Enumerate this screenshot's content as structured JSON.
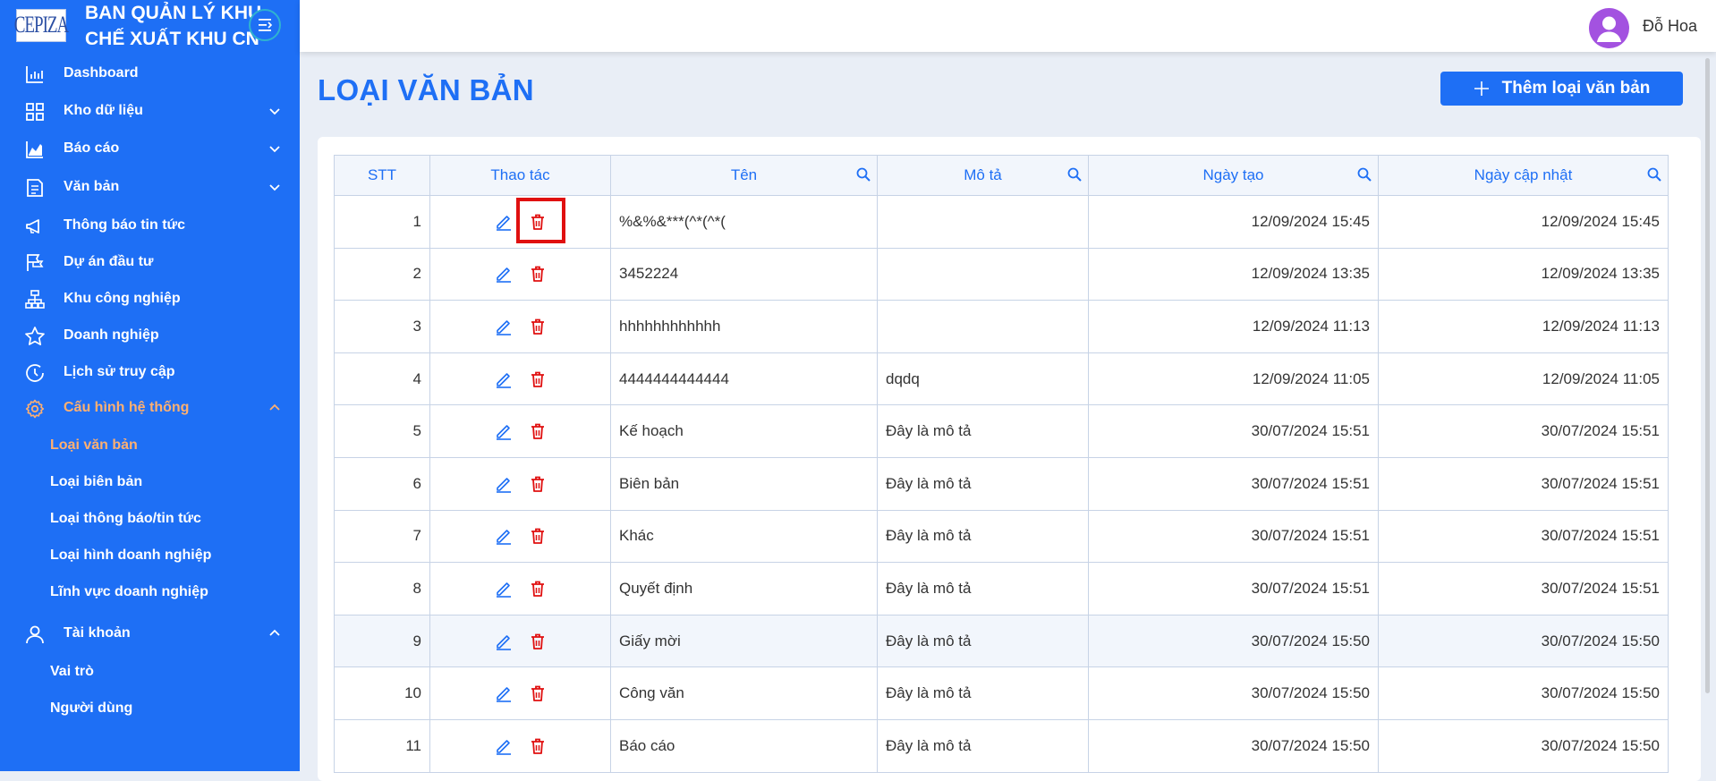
{
  "brand": {
    "logo_text": "CEPIZA",
    "title_line1": "BAN QUẢN LÝ KHU",
    "title_line2": "CHẾ XUẤT KHU CN"
  },
  "sidebar": {
    "items": [
      {
        "label": "Dashboard",
        "icon": "bar-chart-icon"
      },
      {
        "label": "Kho dữ liệu",
        "icon": "grid-icon",
        "chevron": "down"
      },
      {
        "label": "Báo cáo",
        "icon": "area-chart-icon",
        "chevron": "down"
      },
      {
        "label": "Văn bản",
        "icon": "document-icon",
        "chevron": "down"
      },
      {
        "label": "Thông báo tin tức",
        "icon": "megaphone-icon"
      },
      {
        "label": "Dự án đầu tư",
        "icon": "flag-icon"
      },
      {
        "label": "Khu công nghiệp",
        "icon": "sitemap-icon"
      },
      {
        "label": "Doanh nghiệp",
        "icon": "star-icon"
      },
      {
        "label": "Lịch sử truy cập",
        "icon": "clock-icon"
      },
      {
        "label": "Cấu hình hệ thống",
        "icon": "gear-icon",
        "chevron": "up",
        "open": true
      },
      {
        "label": "Tài khoản",
        "icon": "user-icon",
        "chevron": "up"
      }
    ],
    "config_sub": [
      "Loại văn bản",
      "Loại biên bản",
      "Loại thông báo/tin tức",
      "Loại hình doanh nghiệp",
      "Lĩnh vực doanh nghiệp"
    ],
    "account_sub": [
      "Vai trò",
      "Người dùng"
    ],
    "active_color": "#ffb071",
    "bg_color": "#1e6ff5"
  },
  "header": {
    "username": "Đỗ Hoa"
  },
  "main": {
    "title": "LOẠI VĂN BẢN",
    "add_button": "Thêm loại văn bản"
  },
  "table": {
    "columns": [
      "STT",
      "Thao tác",
      "Tên",
      "Mô tả",
      "Ngày tạo",
      "Ngày cập nhật"
    ],
    "rows": [
      {
        "stt": "1",
        "name": "%&%&***(^*(^*(",
        "desc": "",
        "created": "12/09/2024 15:45",
        "updated": "12/09/2024 15:45"
      },
      {
        "stt": "2",
        "name": "3452224",
        "desc": "",
        "created": "12/09/2024 13:35",
        "updated": "12/09/2024 13:35"
      },
      {
        "stt": "3",
        "name": "hhhhhhhhhhhh",
        "desc": "",
        "created": "12/09/2024 11:13",
        "updated": "12/09/2024 11:13"
      },
      {
        "stt": "4",
        "name": "4444444444444",
        "desc": "dqdq",
        "created": "12/09/2024 11:05",
        "updated": "12/09/2024 11:05"
      },
      {
        "stt": "5",
        "name": "Kế hoạch",
        "desc": "Đây là mô tả",
        "created": "30/07/2024 15:51",
        "updated": "30/07/2024 15:51"
      },
      {
        "stt": "6",
        "name": "Biên bản",
        "desc": "Đây là mô tả",
        "created": "30/07/2024 15:51",
        "updated": "30/07/2024 15:51"
      },
      {
        "stt": "7",
        "name": "Khác",
        "desc": "Đây là mô tả",
        "created": "30/07/2024 15:51",
        "updated": "30/07/2024 15:51"
      },
      {
        "stt": "8",
        "name": "Quyết định",
        "desc": "Đây là mô tả",
        "created": "30/07/2024 15:51",
        "updated": "30/07/2024 15:51"
      },
      {
        "stt": "9",
        "name": "Giấy mời",
        "desc": "Đây là mô tả",
        "created": "30/07/2024 15:50",
        "updated": "30/07/2024 15:50"
      },
      {
        "stt": "10",
        "name": "Công văn",
        "desc": "Đây là mô tả",
        "created": "30/07/2024 15:50",
        "updated": "30/07/2024 15:50"
      },
      {
        "stt": "11",
        "name": "Báo cáo",
        "desc": "Đây là mô tả",
        "created": "30/07/2024 15:50",
        "updated": "30/07/2024 15:50"
      }
    ],
    "highlighted_row": "9",
    "header_color": "#1e6ff5",
    "edit_icon": "edit-icon",
    "delete_icon": "trash-icon",
    "delete_color": "#e01010",
    "edit_color": "#1e6ff5"
  }
}
